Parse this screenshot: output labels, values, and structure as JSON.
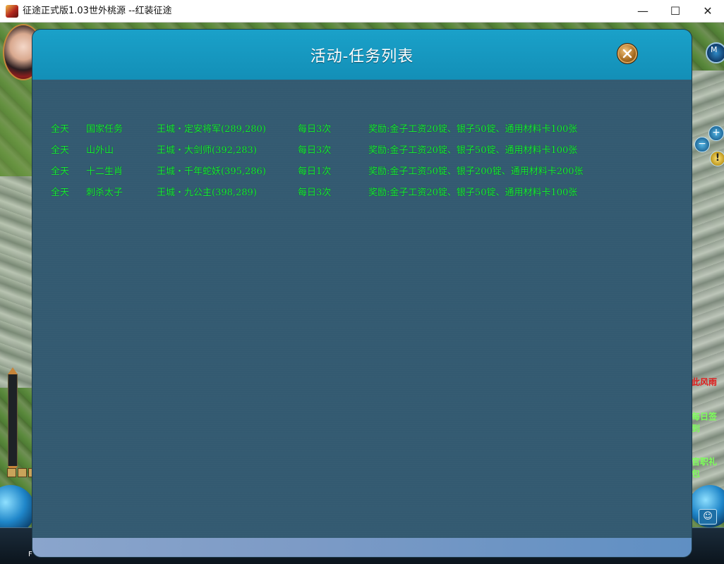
{
  "window": {
    "title": "征途正式版1.03世外桃源 --红装征途",
    "minimize_glyph": "—",
    "maximize_glyph": "☐",
    "close_glyph": "✕"
  },
  "game": {
    "side_labels": {
      "red": "此风雨",
      "checkin": "每日签到",
      "gift": "官职礼包"
    },
    "minimap_button": "M",
    "plus_glyph": "+",
    "minus_glyph": "−",
    "alert_glyph": "!",
    "bottom_label": "F"
  },
  "dialog": {
    "title": "活动-任务列表",
    "close_icon": "close-icon",
    "tasks": [
      {
        "time": "全天",
        "name": "国家任务",
        "location": "王城・定安将军(289,280)",
        "frequency": "每日3次",
        "reward": "奖励:金子工资20锭、银子50锭、通用材料卡100张"
      },
      {
        "time": "全天",
        "name": "山外山",
        "location": "王城・大剑师(392,283)",
        "frequency": "每日3次",
        "reward": "奖励:金子工资20锭、银子50锭、通用材料卡100张"
      },
      {
        "time": "全天",
        "name": "十二生肖",
        "location": "王城・千年蛇妖(395,286)",
        "frequency": "每日1次",
        "reward": "奖励:金子工资50锭、银子200锭、通用材料卡200张"
      },
      {
        "time": "全天",
        "name": "刺杀太子",
        "location": "王城・九公主(398,289)",
        "frequency": "每日3次",
        "reward": "奖励:金子工资20锭、银子50锭、通用材料卡100张"
      }
    ]
  },
  "colors": {
    "dialog_header": "#1aa1c9",
    "dialog_body": "#335a71",
    "task_text": "#18e83a"
  }
}
